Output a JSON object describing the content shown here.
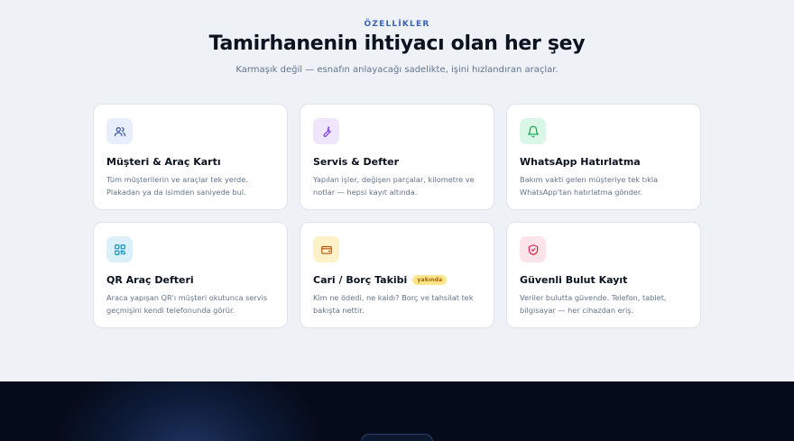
{
  "section": {
    "eyebrow": "ÖZELLİKLER",
    "title": "Tamirhanenin ihtiyacı olan her şey",
    "subtitle": "Karmaşık değil — esnafın anlayacağı sadelikte, işini hızlandıran araçlar."
  },
  "cards": [
    {
      "icon": "users-icon",
      "title": "Müşteri & Araç Kartı",
      "desc": "Tüm müşterilerin ve araçlar tek yerde. Plakadan ya da isimden saniyede bul.",
      "icon_bg": "#e8eefb",
      "icon_color": "#2f4f9e"
    },
    {
      "icon": "wrench-icon",
      "title": "Servis & Defter",
      "desc": "Yapılan işler, değişen parçalar, kilometre ve notlar — hepsi kayıt altında.",
      "icon_bg": "#efe6fb",
      "icon_color": "#7c3aed"
    },
    {
      "icon": "bell-icon",
      "title": "WhatsApp Hatırlatma",
      "desc": "Bakım vakti gelen müşteriye tek tıkla WhatsApp'tan hatırlatma gönder.",
      "icon_bg": "#d9f6e6",
      "icon_color": "#16a34a"
    },
    {
      "icon": "qr-code-icon",
      "title": "QR Araç Defteri",
      "desc": "Araca yapışan QR'ı müşteri okutunca servis geçmişini kendi telefonunda görür.",
      "icon_bg": "#dbf0fa",
      "icon_color": "#0e8fb8"
    },
    {
      "icon": "wallet-icon",
      "title": "Cari / Borç Takibi",
      "badge": "yakında",
      "desc": "Kim ne ödedi, ne kaldı? Borç ve tahsilat tek bakışta nettir.",
      "icon_bg": "#fdf1c7",
      "icon_color": "#b45309"
    },
    {
      "icon": "shield-check-icon",
      "title": "Güvenli Bulut Kayıt",
      "desc": "Veriler bulutta güvende. Telefon, tablet, bilgisayar — her cihazdan eriş.",
      "icon_bg": "#fde4e8",
      "icon_color": "#e11d48"
    }
  ]
}
